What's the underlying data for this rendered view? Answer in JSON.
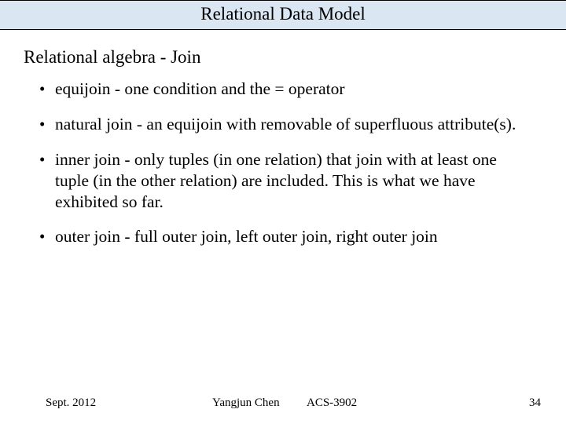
{
  "title": "Relational Data Model",
  "subtitle": "Relational algebra - Join",
  "bullets": [
    "equijoin - one condition and the = operator",
    "natural join - an equijoin with removable of superfluous attribute(s).",
    "inner join - only tuples (in one relation) that join with at least one tuple (in the other relation) are included. This is what we have exhibited so far.",
    "outer join - full outer join, left outer join, right outer join"
  ],
  "footer": {
    "date": "Sept. 2012",
    "author": "Yangjun Chen",
    "course": "ACS-3902",
    "page": "34"
  }
}
